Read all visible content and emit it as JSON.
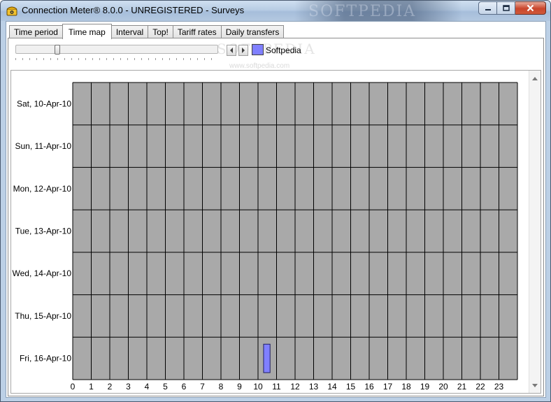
{
  "window": {
    "title": "Connection Meter® 8.0.0 - UNREGISTERED - Surveys",
    "app_icon": "telephone-icon",
    "minimize_icon": "minimize-icon",
    "maximize_icon": "maximize-icon",
    "close_icon": "close-icon"
  },
  "tabs": [
    {
      "label": "Time period",
      "active": false
    },
    {
      "label": "Time map",
      "active": true
    },
    {
      "label": "Interval",
      "active": false
    },
    {
      "label": "Top!",
      "active": false
    },
    {
      "label": "Tariff rates",
      "active": false
    },
    {
      "label": "Daily transfers",
      "active": false
    }
  ],
  "toolbar": {
    "prev_icon": "chevron-left-icon",
    "next_icon": "chevron-right-icon",
    "legend_label": "Softpedia",
    "legend_color": "#8080ff"
  },
  "watermark": {
    "logo_text": "SOFTPEDIA",
    "url": "www.softpedia.com"
  },
  "chart_data": {
    "type": "heatmap",
    "title": "",
    "xlabel": "",
    "ylabel": "",
    "x_ticks": [
      "0",
      "1",
      "2",
      "3",
      "4",
      "5",
      "6",
      "7",
      "8",
      "9",
      "10",
      "11",
      "12",
      "13",
      "14",
      "15",
      "16",
      "17",
      "18",
      "19",
      "20",
      "21",
      "22",
      "23"
    ],
    "xlim": [
      0,
      24
    ],
    "rows": [
      "Sat, 10-Apr-10",
      "Sun, 11-Apr-10",
      "Mon, 12-Apr-10",
      "Tue, 13-Apr-10",
      "Wed, 14-Apr-10",
      "Thu, 15-Apr-10",
      "Fri, 16-Apr-10"
    ],
    "grid": true,
    "cell_color": "#a9a9a9",
    "series": [
      {
        "name": "Softpedia",
        "color": "#8080ff",
        "sessions": [
          {
            "day": "Fri, 16-Apr-10",
            "start_hour": 10.3,
            "end_hour": 10.65
          }
        ]
      }
    ]
  }
}
